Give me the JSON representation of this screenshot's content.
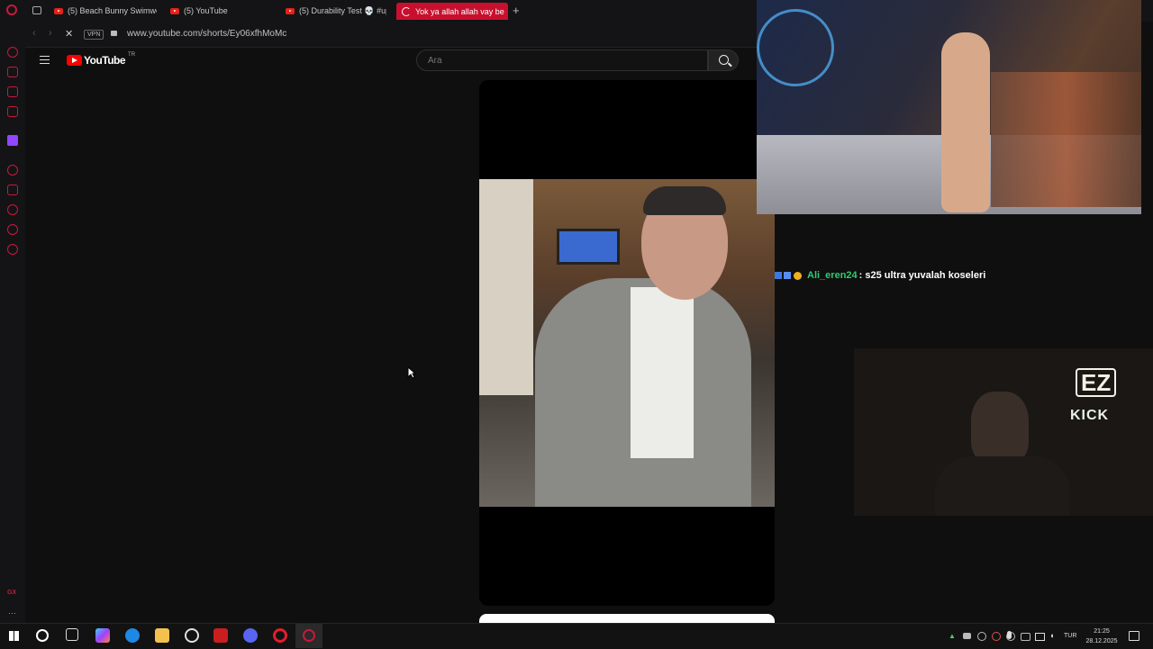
{
  "browser": {
    "tabs": [
      {
        "title": "(5) Beach Bunny Swimwe"
      },
      {
        "title": "(5) YouTube"
      },
      {
        "title": "(5) Durability Test 💀 #up"
      },
      {
        "title": "Yok ya allah allah vay be"
      }
    ],
    "new_tab_label": "+",
    "vpn_label": "VPN",
    "url": "www.youtube.com/shorts/Ey06xfhMoMc"
  },
  "youtube": {
    "logo_text": "YouTube",
    "region": "TR",
    "search_placeholder": "Ara"
  },
  "stream_overlay": {
    "chat_user": "Ali_eren24",
    "chat_message": ": s25 ultra yuvalah koseleri",
    "user_color": "#2ecc71",
    "ez_label": "EZ",
    "kick_label": "KICK"
  },
  "sidebar_bottom_label": "GX",
  "taskbar": {
    "language": "TUR",
    "time": "21:25",
    "date": "28.12.2025"
  },
  "colors": {
    "accent": "#c8102e",
    "background": "#0f0f0f"
  }
}
